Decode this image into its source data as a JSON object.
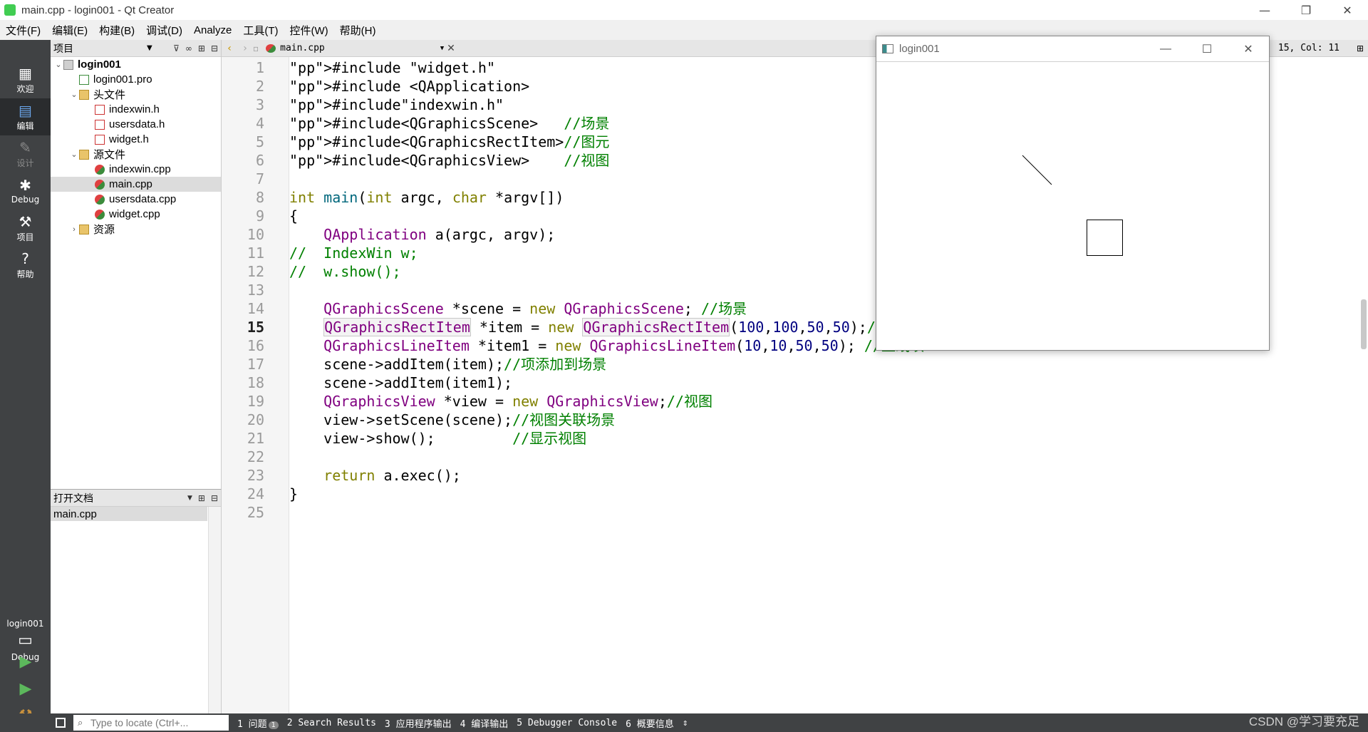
{
  "titlebar": {
    "title": "main.cpp - login001 - Qt Creator",
    "minimize": "—",
    "restore": "❐",
    "close": "✕"
  },
  "menu": [
    "文件(F)",
    "编辑(E)",
    "构建(B)",
    "调试(D)",
    "Analyze",
    "工具(T)",
    "控件(W)",
    "帮助(H)"
  ],
  "modes": [
    {
      "label": "欢迎",
      "icon": "grid-icon"
    },
    {
      "label": "编辑",
      "icon": "edit-icon"
    },
    {
      "label": "设计",
      "icon": "pencil-icon"
    },
    {
      "label": "Debug",
      "icon": "bug-icon"
    },
    {
      "label": "项目",
      "icon": "wrench-icon"
    },
    {
      "label": "帮助",
      "icon": "help-icon"
    }
  ],
  "target": {
    "name": "login001",
    "config": "Debug"
  },
  "project_panel": {
    "header": "项目"
  },
  "tree": [
    {
      "label": "login001",
      "level": 0,
      "arrow": "⌄",
      "icon": "proj",
      "bold": true
    },
    {
      "label": "login001.pro",
      "level": 1,
      "arrow": "",
      "icon": "pro"
    },
    {
      "label": "头文件",
      "level": 1,
      "arrow": "⌄",
      "icon": "folder"
    },
    {
      "label": "indexwin.h",
      "level": 2,
      "arrow": "",
      "icon": "h"
    },
    {
      "label": "usersdata.h",
      "level": 2,
      "arrow": "",
      "icon": "h"
    },
    {
      "label": "widget.h",
      "level": 2,
      "arrow": "",
      "icon": "h"
    },
    {
      "label": "源文件",
      "level": 1,
      "arrow": "⌄",
      "icon": "folder"
    },
    {
      "label": "indexwin.cpp",
      "level": 2,
      "arrow": "",
      "icon": "cpp"
    },
    {
      "label": "main.cpp",
      "level": 2,
      "arrow": "",
      "icon": "cpp",
      "selected": true
    },
    {
      "label": "usersdata.cpp",
      "level": 2,
      "arrow": "",
      "icon": "cpp"
    },
    {
      "label": "widget.cpp",
      "level": 2,
      "arrow": "",
      "icon": "cpp"
    },
    {
      "label": "资源",
      "level": 1,
      "arrow": "›",
      "icon": "folder"
    }
  ],
  "open_docs": {
    "header": "打开文档",
    "items": [
      "main.cpp"
    ]
  },
  "editor": {
    "file": "main.cpp",
    "cursor": "15, Col: 11",
    "current_line": 15
  },
  "code_lines": [
    "#include \"widget.h\"",
    "#include <QApplication>",
    "#include\"indexwin.h\"",
    "#include<QGraphicsScene>   //场景",
    "#include<QGraphicsRectItem>//图元",
    "#include<QGraphicsView>    //视图",
    "",
    "int main(int argc, char *argv[])",
    "{",
    "    QApplication a(argc, argv);",
    "//  IndexWin w;",
    "//  w.show();",
    "",
    "    QGraphicsScene *scene = new QGraphicsScene; //场景",
    "    QGraphicsRectItem *item = new QGraphicsRectItem(100,100,50,50);//矩形项",
    "    QGraphicsLineItem *item1 = new QGraphicsLineItem(10,10,50,50); //直线项",
    "    scene->addItem(item);//项添加到场景",
    "    scene->addItem(item1);",
    "    QGraphicsView *view = new QGraphicsView;//视图",
    "    view->setScene(scene);//视图关联场景",
    "    view->show();         //显示视图",
    "",
    "    return a.exec();",
    "}",
    ""
  ],
  "statusbar": {
    "locator_placeholder": "Type to locate (Ctrl+...",
    "tabs": [
      {
        "label": "1 问题",
        "badge": "1"
      },
      {
        "label": "2 Search Results"
      },
      {
        "label": "3 应用程序输出"
      },
      {
        "label": "4 编译输出"
      },
      {
        "label": "5 Debugger Console"
      },
      {
        "label": "6 概要信息"
      }
    ],
    "watermark": "CSDN @学习要充足"
  },
  "app_window": {
    "title": "login001",
    "minimize": "—",
    "maximize": "☐",
    "close": "✕"
  }
}
